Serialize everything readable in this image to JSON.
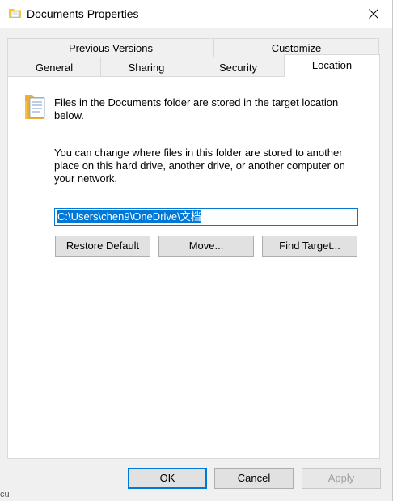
{
  "window": {
    "title": "Documents Properties"
  },
  "tabs": {
    "row1": [
      {
        "label": "Previous Versions"
      },
      {
        "label": "Customize"
      }
    ],
    "row2": [
      {
        "label": "General"
      },
      {
        "label": "Sharing"
      },
      {
        "label": "Security"
      },
      {
        "label": "Location",
        "active": true
      }
    ]
  },
  "location": {
    "intro": "Files in the Documents folder are stored in the target location below.",
    "description": "You can change where files in this folder are stored to another place on this hard drive, another drive, or another computer on your network.",
    "path_value": "C:\\Users\\chen9\\OneDrive\\文档",
    "buttons": {
      "restore": "Restore Default",
      "move": "Move...",
      "find": "Find Target..."
    }
  },
  "footer": {
    "ok": "OK",
    "cancel": "Cancel",
    "apply": "Apply"
  },
  "corner_text": "cu",
  "colors": {
    "accent": "#0078d7",
    "folder": "#f5c542",
    "disabled_text": "#a0a0a0"
  },
  "icons": {
    "title": "documents-folder-icon",
    "close": "close-icon",
    "folder": "documents-folder-icon"
  }
}
